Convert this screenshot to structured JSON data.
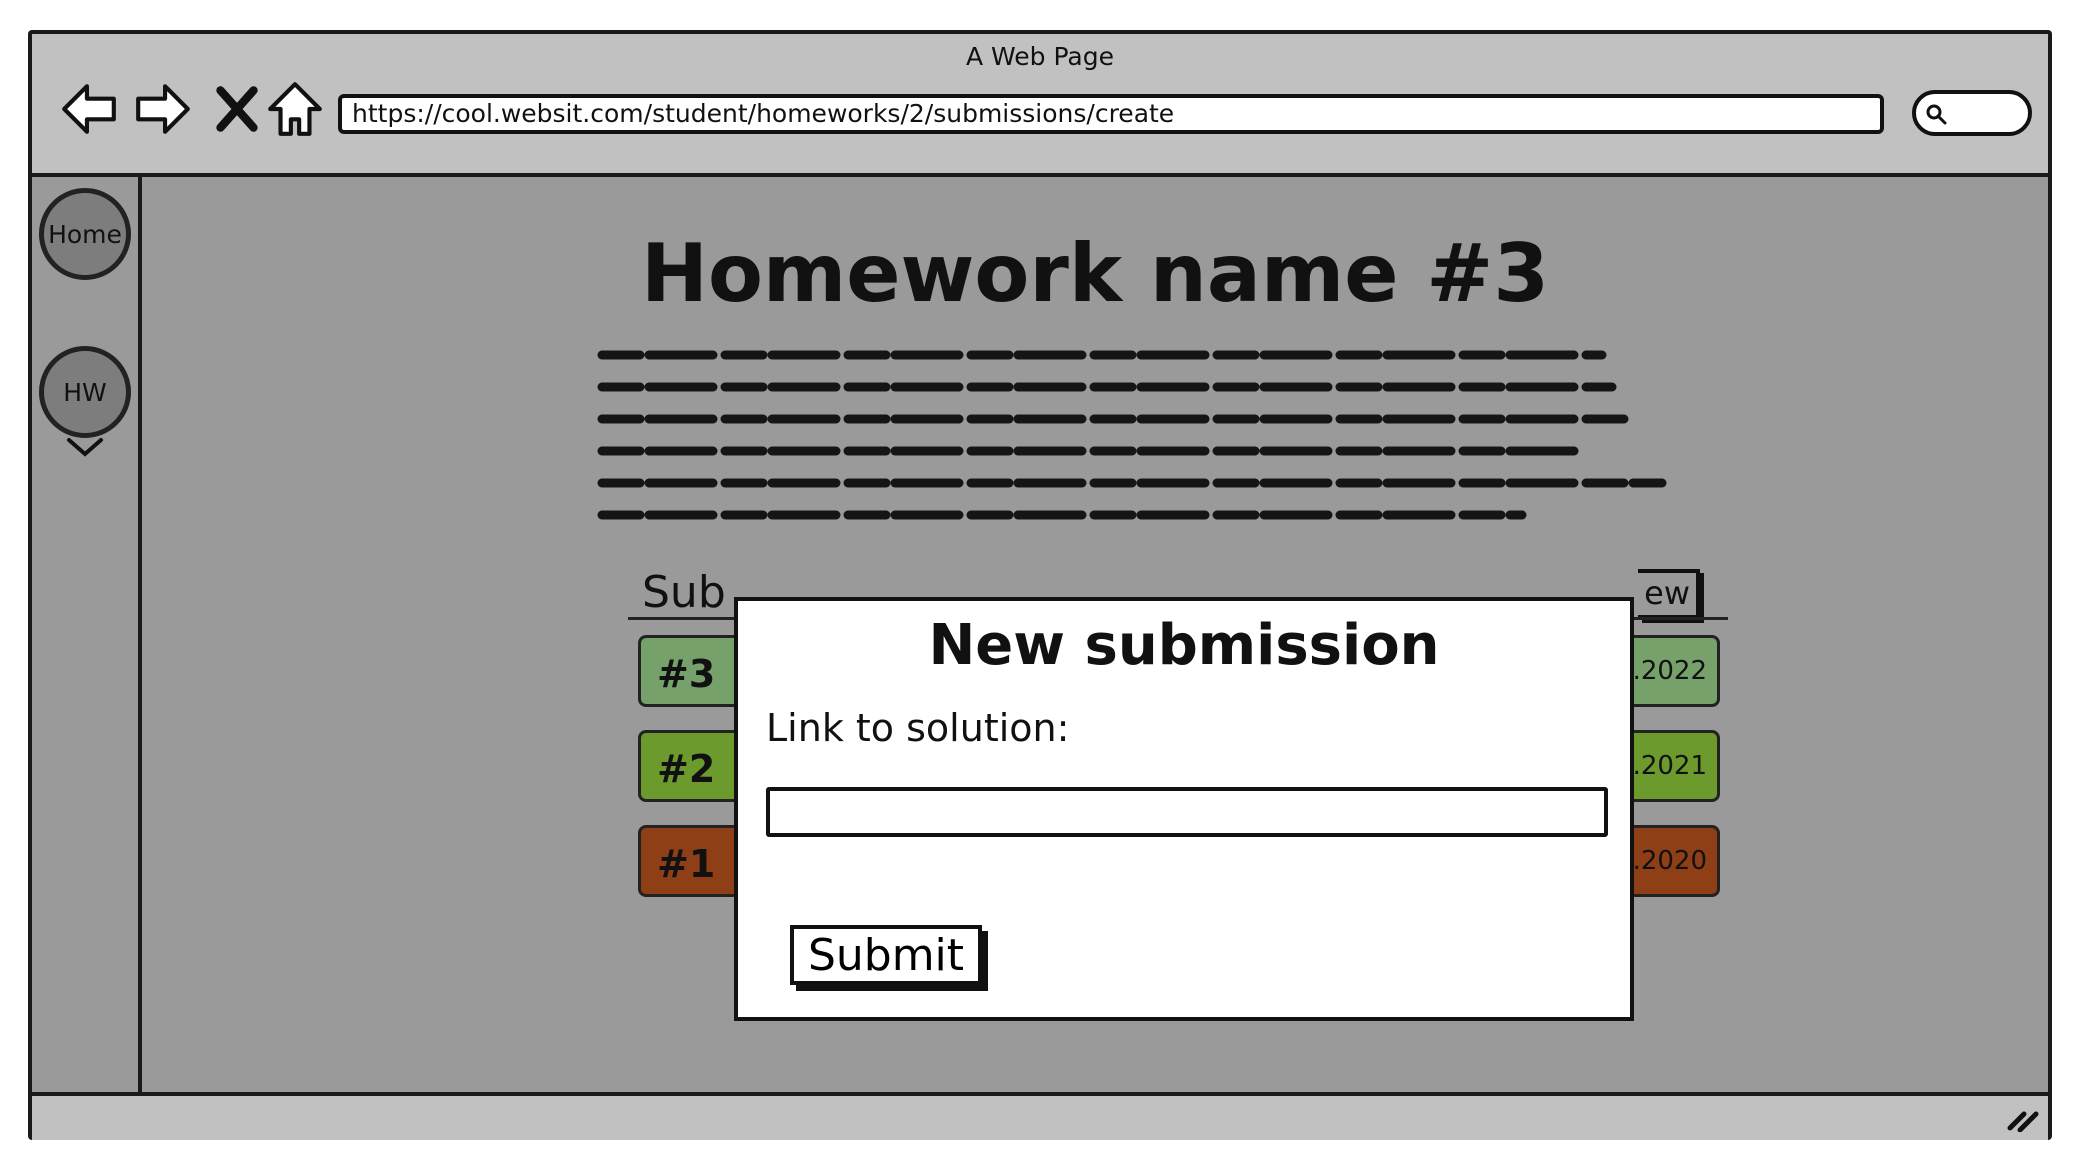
{
  "window": {
    "title": "A Web Page"
  },
  "browser": {
    "url": "https://cool.websit.com/student/homeworks/2/submissions/create",
    "nav_icons": [
      "back-icon",
      "forward-icon",
      "stop-icon",
      "home-icon"
    ],
    "search_icon": "search-icon"
  },
  "sidebar": {
    "items": [
      {
        "label": "Home"
      },
      {
        "label": "HW"
      }
    ],
    "separator_icon": "chevron-down-icon"
  },
  "page": {
    "title": "Homework name #3",
    "section_title": "Sub",
    "new_button_label": "ew"
  },
  "submissions": [
    {
      "number": "#3",
      "date": ".2022",
      "color": "#77a16b"
    },
    {
      "number": "#2",
      "date": ".2021",
      "color": "#6c9a2c"
    },
    {
      "number": "#1",
      "date": ".2020",
      "color": "#8e3f15"
    }
  ],
  "modal": {
    "title": "New submission",
    "field_label": "Link to solution:",
    "field_value": "",
    "submit_label": "Submit"
  },
  "colors": {
    "chrome": "#c1c1c1",
    "overlay": "#9a9a9a",
    "modal_bg": "#ffffff"
  }
}
